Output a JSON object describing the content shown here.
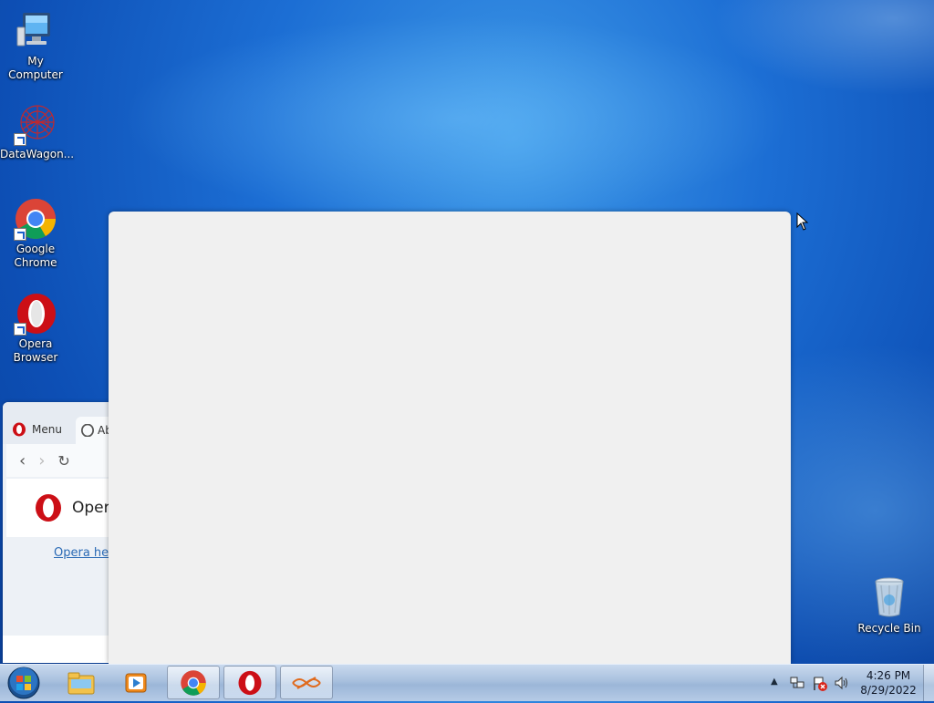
{
  "desktop": {
    "icons": [
      {
        "label": "My Computer"
      },
      {
        "label": "DataWagon..."
      },
      {
        "label_line1": "Google",
        "label_line2": "Chrome"
      },
      {
        "label_line1": "Opera",
        "label_line2": "Browser"
      },
      {
        "label": "Recycle Bin"
      }
    ]
  },
  "opera_window": {
    "menu_label": "Menu",
    "tab_label": "Ab",
    "page_title": "Oper",
    "help_link": "Opera help"
  },
  "taskbar": {
    "pinned": [
      "windows-explorer-icon",
      "media-player-icon",
      "chrome-icon",
      "opera-icon",
      "datawagon-icon"
    ],
    "clock": {
      "time": "4:26 PM",
      "date": "8/29/2022"
    }
  },
  "colors": {
    "desktop_blue": "#1c6ed4",
    "opera_red": "#cc0f16",
    "taskbar": "#a8c0de"
  }
}
